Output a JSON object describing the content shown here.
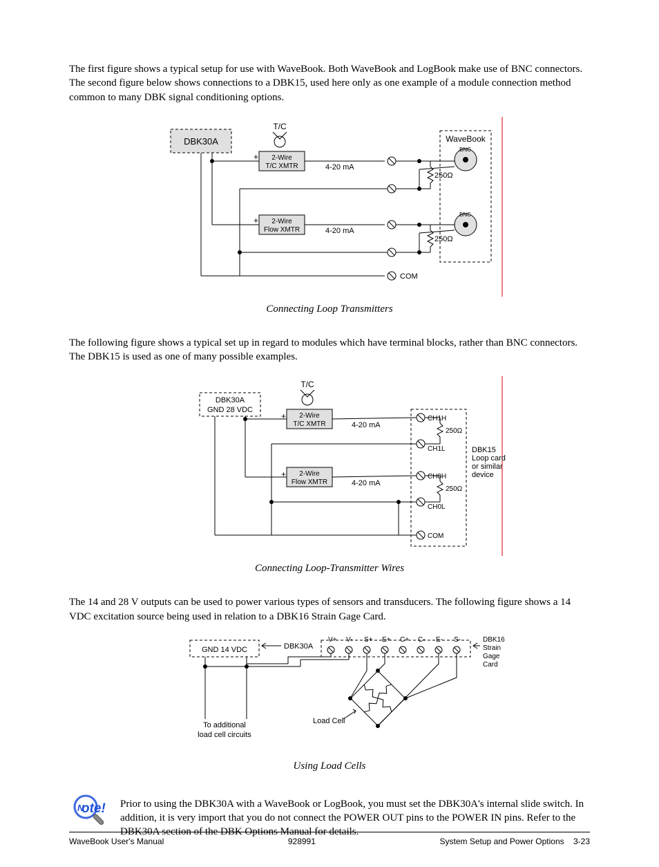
{
  "para1": "The first figure shows a typical setup for use with WaveBook. Both WaveBook and LogBook make use of BNC connectors. The second figure below shows connections to a DBK15, used here only as one example of a module connection method common to many DBK signal conditioning options.",
  "fig1": {
    "box_dbk30a": "DBK30A",
    "tc": "T/C",
    "xmtr1_a": "2-Wire",
    "xmtr1_b": "T/C XMTR",
    "xmtr2_a": "2-Wire",
    "xmtr2_b": "Flow XMTR",
    "current": "4-20 mA",
    "r": "250Ω",
    "com": "COM",
    "dest": "WaveBook",
    "bnc": "BNC"
  },
  "cap1": "Connecting Loop Transmitters",
  "para2": "The following figure shows a typical set up in regard to modules which have terminal blocks, rather than BNC connectors. The DBK15 is used as one of many possible examples.",
  "fig2": {
    "box_line1": "DBK30A",
    "box_line2": "GND  28 VDC",
    "tc": "T/C",
    "xmtr1_a": "2-Wire",
    "xmtr1_b": "T/C XMTR",
    "xmtr2_a": "2-Wire",
    "xmtr2_b": "Flow XMTR",
    "current": "4-20 mA",
    "r": "250Ω",
    "ch1h": "CH1H",
    "ch1l": "CH1L",
    "ch0h": "CH0H",
    "ch0l": "CH0L",
    "com": "COM",
    "dest_a": "DBK15",
    "dest_b": "Loop card",
    "dest_c": "or similar",
    "dest_d": "device"
  },
  "cap2": "Connecting Loop-Transmitter Wires",
  "para3": "The 14 and 28 V outputs can be used to power various types of sensors and transducers. The following figure shows a 14 VDC excitation source being used in relation to a DBK16 Strain Gage Card.",
  "fig3": {
    "box_line1": "GND 14 VDC",
    "arrow_label": "DBK30A",
    "terminals": [
      "V+",
      "V-",
      "S+",
      "E+",
      "C+",
      "C-",
      "E-",
      "S-"
    ],
    "dest_a": "DBK16",
    "dest_b": "Strain",
    "dest_c": "Gage",
    "dest_d": "Card",
    "load": "Load Cell",
    "footer_a": "To additional",
    "footer_b": "load cell circuits"
  },
  "cap3": "Using Load Cells",
  "note": "Prior to using the DBK30A with a WaveBook or LogBook, you must set the DBK30A's internal slide switch. In addition, it is very import that you do not connect the POWER OUT pins to the POWER IN pins. Refer to the DBK30A section of the DBK Options Manual for details.",
  "footer_left": "WaveBook User's Manual",
  "footer_mid": "928991",
  "footer_right_a": "System Setup and Power Options",
  "footer_right_b": "3-23"
}
